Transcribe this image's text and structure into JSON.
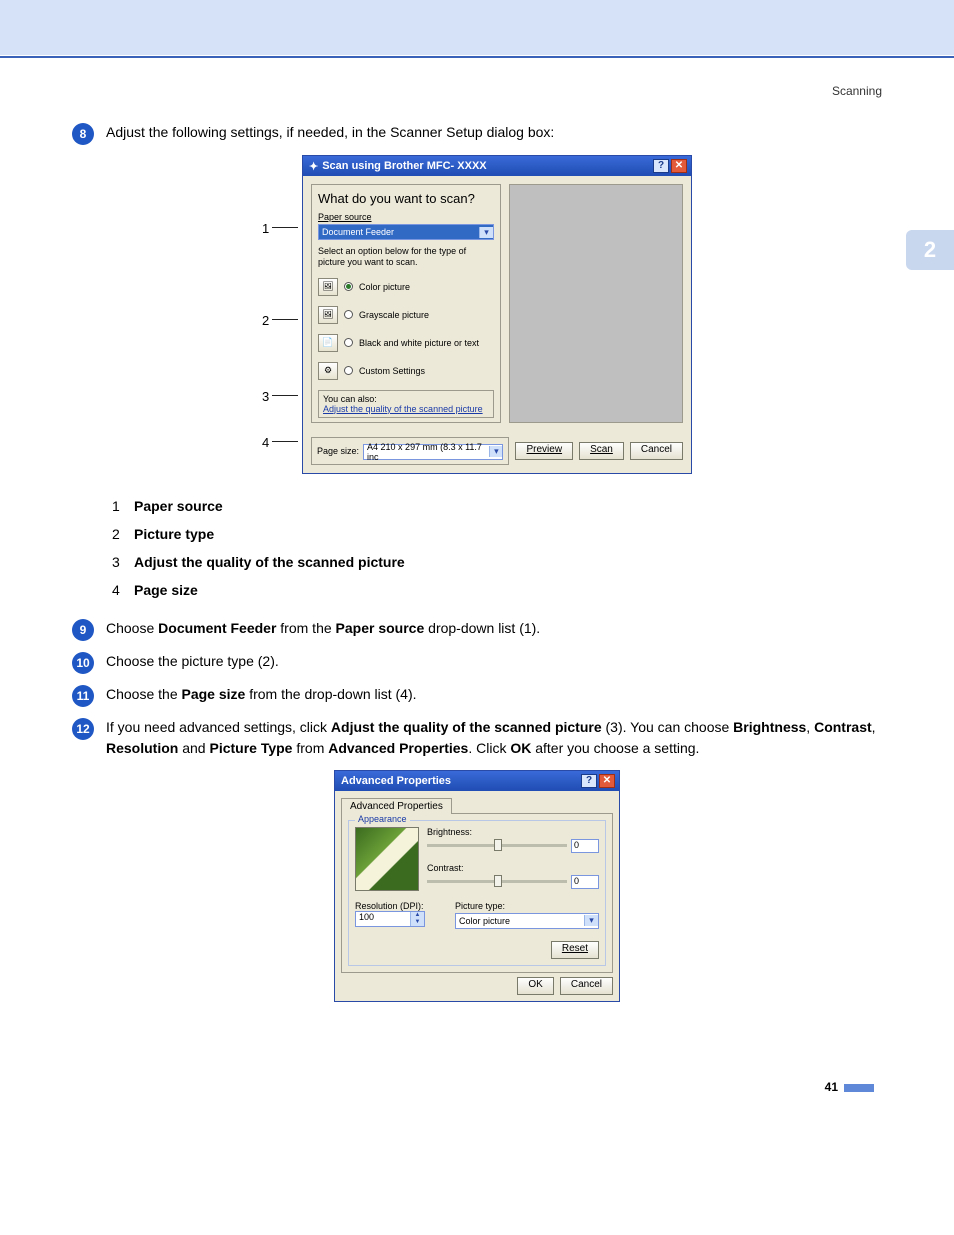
{
  "header": {
    "section": "Scanning"
  },
  "side_tab": "2",
  "page_number": "41",
  "steps": {
    "s8": {
      "num": "8",
      "text_pre": "Adjust the following settings, if needed, in the Scanner Setup dialog box:"
    },
    "s9": {
      "num": "9",
      "text_pre": "Choose ",
      "b1": "Document Feeder",
      "mid": " from the ",
      "b2": "Paper source",
      "post": " drop-down list (1)."
    },
    "s10": {
      "num": "10",
      "text": "Choose the picture type (2)."
    },
    "s11": {
      "num": "11",
      "text_pre": "Choose the ",
      "b1": "Page size",
      "post": " from the drop-down list (4)."
    },
    "s12": {
      "num": "12",
      "t1": "If you need advanced settings, click ",
      "b1": "Adjust the quality of the scanned picture",
      "t2": " (3). You can choose ",
      "b2": "Brightness",
      "c1": ", ",
      "b3": "Contrast",
      "c2": ", ",
      "b4": "Resolution",
      "t3": " and ",
      "b5": "Picture Type",
      "t4": " from ",
      "b6": "Advanced Properties",
      "t5": ". Click ",
      "b7": "OK",
      "t6": " after you choose a setting."
    }
  },
  "sublist": {
    "i1": {
      "n": "1",
      "label": "Paper source"
    },
    "i2": {
      "n": "2",
      "label": "Picture type"
    },
    "i3": {
      "n": "3",
      "label": "Adjust the quality of the scanned picture"
    },
    "i4": {
      "n": "4",
      "label": "Page size"
    }
  },
  "dlg1": {
    "title": "Scan using Brother MFC- XXXX",
    "heading": "What do you want to scan?",
    "paper_source_label": "Paper source",
    "paper_source_value": "Document Feeder",
    "select_help": "Select an option below for the type of picture you want to scan.",
    "opt_color": "Color picture",
    "opt_gray": "Grayscale picture",
    "opt_bw": "Black and white picture or text",
    "opt_custom": "Custom Settings",
    "youcan": "You can also:",
    "adjust_link": "Adjust the quality of the scanned picture",
    "page_size_label": "Page size:",
    "page_size_value": "A4 210 x 297 mm (8.3 x 11.7 inc",
    "btn_preview": "Preview",
    "btn_scan": "Scan",
    "btn_cancel": "Cancel"
  },
  "callouts": {
    "c1": "1",
    "c2": "2",
    "c3": "3",
    "c4": "4"
  },
  "dlg2": {
    "title": "Advanced Properties",
    "tab": "Advanced Properties",
    "legend": "Appearance",
    "brightness": "Brightness:",
    "contrast": "Contrast:",
    "val0a": "0",
    "val0b": "0",
    "res_label": "Resolution (DPI):",
    "res_value": "100",
    "pic_label": "Picture type:",
    "pic_value": "Color picture",
    "reset": "Reset",
    "ok": "OK",
    "cancel": "Cancel"
  }
}
